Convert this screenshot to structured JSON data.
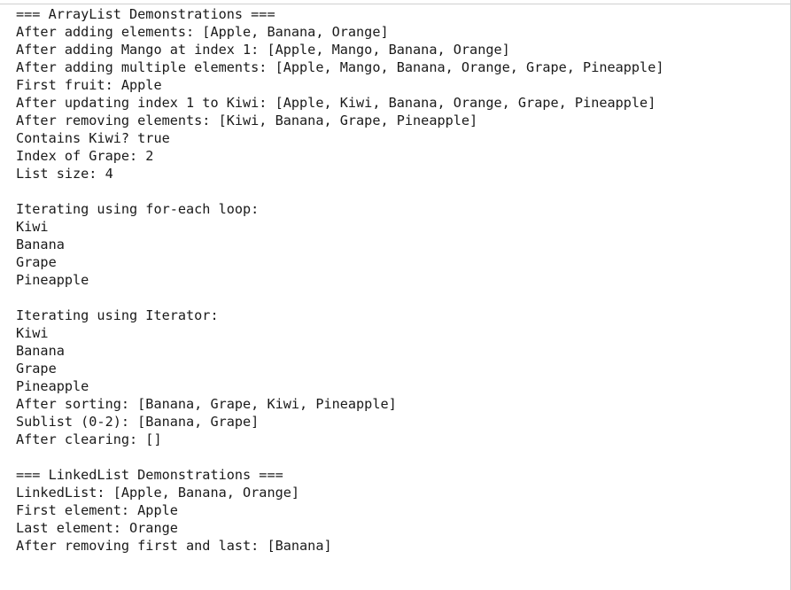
{
  "console": {
    "lines": [
      "=== ArrayList Demonstrations ===",
      "After adding elements: [Apple, Banana, Orange]",
      "After adding Mango at index 1: [Apple, Mango, Banana, Orange]",
      "After adding multiple elements: [Apple, Mango, Banana, Orange, Grape, Pineapple]",
      "First fruit: Apple",
      "After updating index 1 to Kiwi: [Apple, Kiwi, Banana, Orange, Grape, Pineapple]",
      "After removing elements: [Kiwi, Banana, Grape, Pineapple]",
      "Contains Kiwi? true",
      "Index of Grape: 2",
      "List size: 4",
      "",
      "Iterating using for-each loop:",
      "Kiwi",
      "Banana",
      "Grape",
      "Pineapple",
      "",
      "Iterating using Iterator:",
      "Kiwi",
      "Banana",
      "Grape",
      "Pineapple",
      "After sorting: [Banana, Grape, Kiwi, Pineapple]",
      "Sublist (0-2): [Banana, Grape]",
      "After clearing: []",
      "",
      "=== LinkedList Demonstrations ===",
      "LinkedList: [Apple, Banana, Orange]",
      "First element: Apple",
      "Last element: Orange",
      "After removing first and last: [Banana]"
    ]
  }
}
